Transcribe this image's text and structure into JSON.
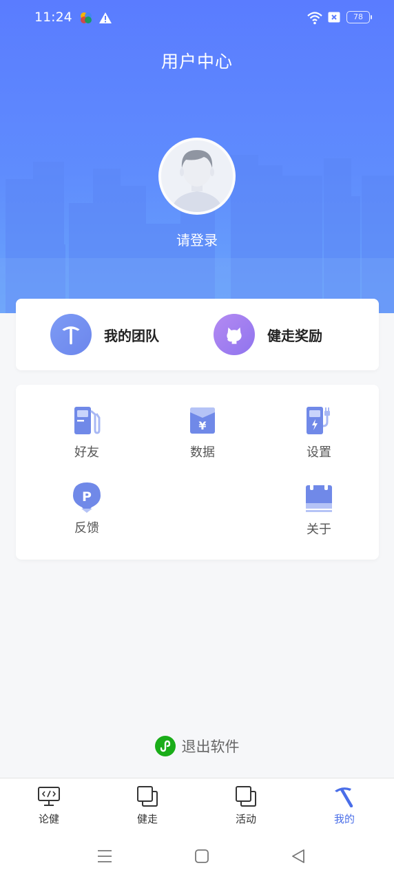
{
  "status_bar": {
    "time": "11:24",
    "battery": "78",
    "icons": [
      "app-icon",
      "warning-icon",
      "wifi-icon",
      "no-sim-icon",
      "battery-icon"
    ]
  },
  "header": {
    "title": "用户中心",
    "login_prompt": "请登录"
  },
  "quick_actions": [
    {
      "label": "我的团队",
      "icon": "pickaxe-icon",
      "color": "#6f8ff0"
    },
    {
      "label": "健走奖励",
      "icon": "github-cat-icon",
      "color": "#a27ef0"
    }
  ],
  "grid": [
    {
      "label": "好友",
      "icon": "fuel-pump-icon"
    },
    {
      "label": "数据",
      "icon": "yuan-envelope-icon"
    },
    {
      "label": "设置",
      "icon": "charging-station-icon"
    },
    {
      "label": "反馈",
      "icon": "parking-pin-icon"
    },
    {
      "label": "关于",
      "icon": "calendar-icon"
    }
  ],
  "logout": {
    "label": "退出软件",
    "icon": "mini-program-icon",
    "color": "#1aad19"
  },
  "tabbar": [
    {
      "label": "论健",
      "icon": "monitor-code-icon",
      "active": false
    },
    {
      "label": "健走",
      "icon": "copy-squares-icon",
      "active": false
    },
    {
      "label": "活动",
      "icon": "copy-squares-icon",
      "active": false
    },
    {
      "label": "我的",
      "icon": "pickaxe-icon",
      "active": true
    }
  ],
  "colors": {
    "accent": "#4a6ee8",
    "header_top": "#5a7cff",
    "header_bottom": "#6aa6fb",
    "icon_blue": "#6f8ff0"
  }
}
